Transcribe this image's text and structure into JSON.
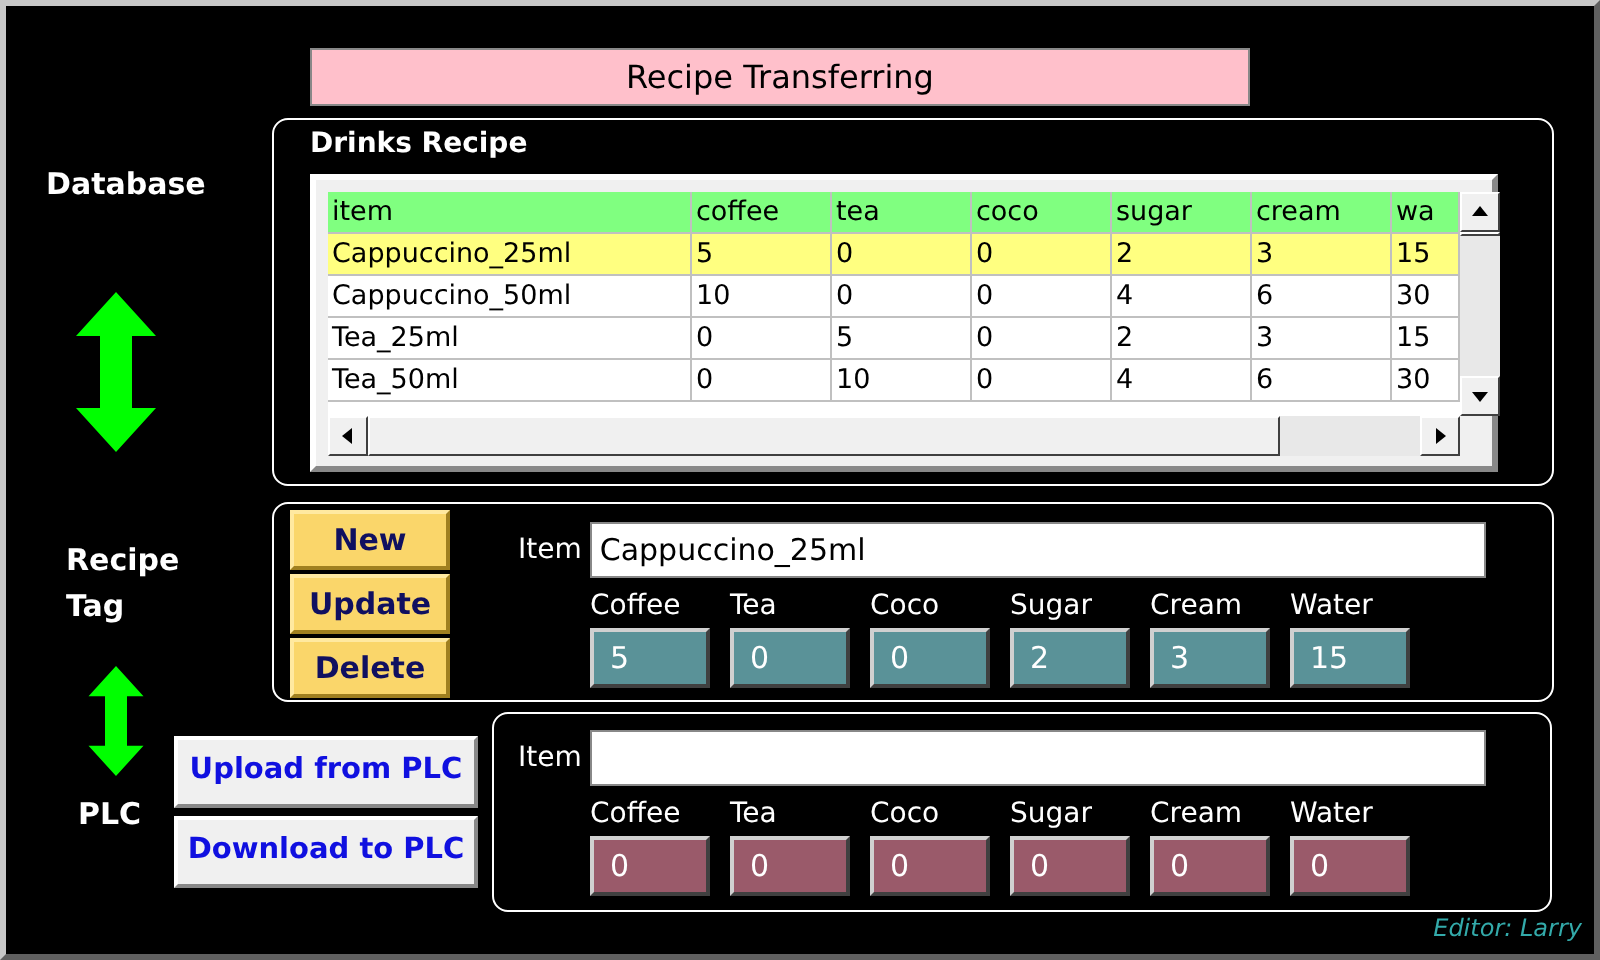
{
  "title": "Recipe Transferring",
  "side_labels": {
    "database": "Database",
    "recipe_tag": "Recipe Tag",
    "plc": "PLC"
  },
  "drinks_recipe": {
    "title": "Drinks Recipe",
    "columns": [
      "item",
      "coffee",
      "tea",
      "coco",
      "sugar",
      "cream",
      "wa"
    ],
    "rows": [
      {
        "cells": [
          "Cappuccino_25ml",
          "5",
          "0",
          "0",
          "2",
          "3",
          "15"
        ],
        "selected": true
      },
      {
        "cells": [
          "Cappuccino_50ml",
          "10",
          "0",
          "0",
          "4",
          "6",
          "30"
        ],
        "selected": false
      },
      {
        "cells": [
          "Tea_25ml",
          "0",
          "5",
          "0",
          "2",
          "3",
          "15"
        ],
        "selected": false
      },
      {
        "cells": [
          "Tea_50ml",
          "0",
          "10",
          "0",
          "4",
          "6",
          "30"
        ],
        "selected": false
      }
    ]
  },
  "recipe_tag": {
    "buttons": [
      "New",
      "Update",
      "Delete"
    ],
    "item_label": "Item",
    "item_value": "Cappuccino_25ml",
    "fields": [
      {
        "label": "Coffee",
        "value": "5"
      },
      {
        "label": "Tea",
        "value": "0"
      },
      {
        "label": "Coco",
        "value": "0"
      },
      {
        "label": "Sugar",
        "value": "2"
      },
      {
        "label": "Cream",
        "value": "3"
      },
      {
        "label": "Water",
        "value": "15"
      }
    ]
  },
  "plc": {
    "buttons": [
      "Upload from PLC",
      "Download to PLC"
    ],
    "item_label": "Item",
    "fields": [
      {
        "label": "Coffee",
        "value": "0"
      },
      {
        "label": "Tea",
        "value": "0"
      },
      {
        "label": "Coco",
        "value": "0"
      },
      {
        "label": "Sugar",
        "value": "0"
      },
      {
        "label": "Cream",
        "value": "0"
      },
      {
        "label": "Water",
        "value": "0"
      }
    ]
  },
  "footer": "Editor: Larry"
}
